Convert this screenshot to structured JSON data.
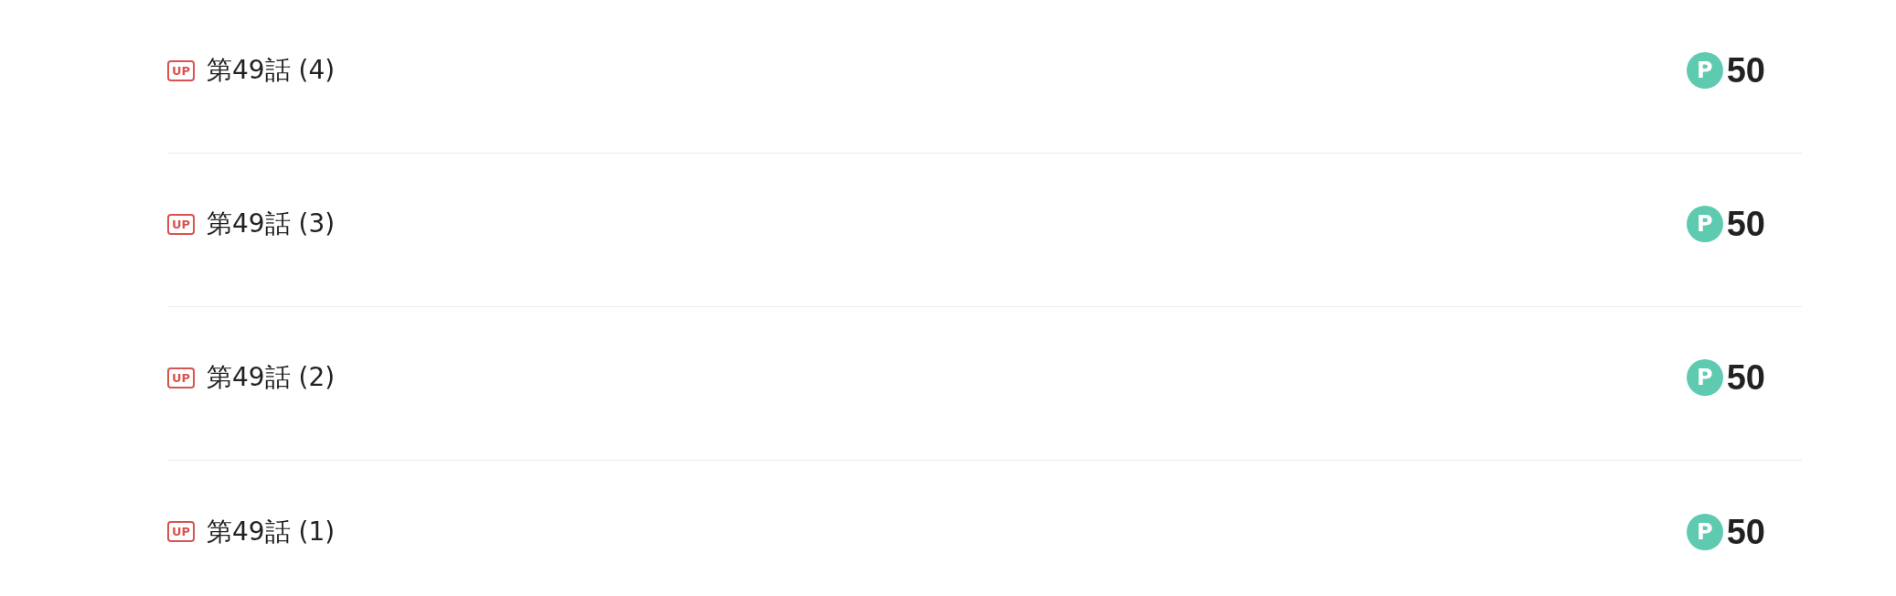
{
  "episodes": [
    {
      "badge": "UP",
      "title": "第49話 (4)",
      "currency": "P",
      "price": "50"
    },
    {
      "badge": "UP",
      "title": "第49話 (3)",
      "currency": "P",
      "price": "50"
    },
    {
      "badge": "UP",
      "title": "第49話 (2)",
      "currency": "P",
      "price": "50"
    },
    {
      "badge": "UP",
      "title": "第49話 (1)",
      "currency": "P",
      "price": "50"
    }
  ]
}
